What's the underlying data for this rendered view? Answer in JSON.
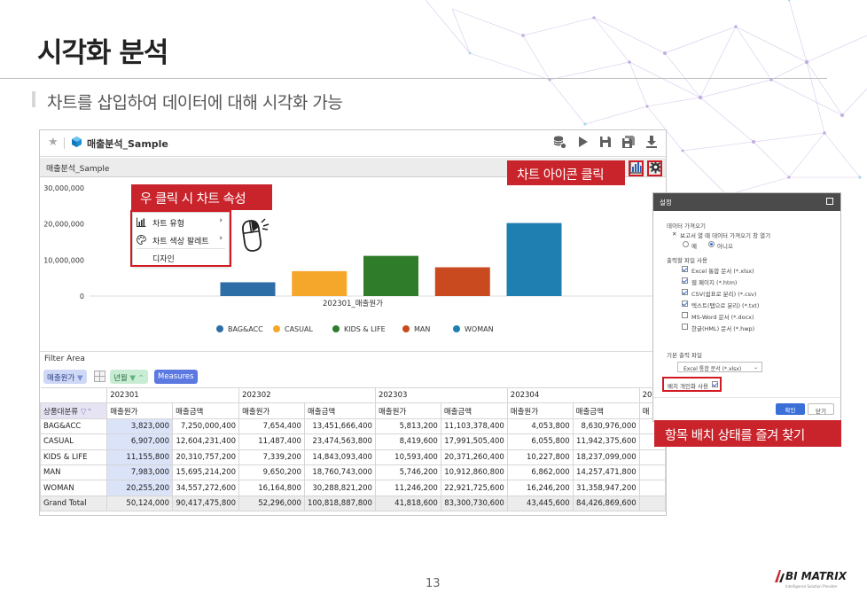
{
  "slide": {
    "title": "시각화 분석",
    "subtitle": "차트를 삽입하여 데이터에 대해 시각화 가능",
    "page_number": "13",
    "logo": {
      "text": "BI MATRIX",
      "tagline": "Intelligence Solution Provider"
    }
  },
  "window": {
    "report_title": "매출분석_Sample",
    "sheet_title": "매출분석_Sample",
    "toolbar_icons": [
      "database-run-icon",
      "play-icon",
      "save-icon",
      "save-as-icon",
      "download-icon"
    ],
    "chart_tool_icons": [
      "bar-chart-icon",
      "gear-icon"
    ]
  },
  "chart_data": {
    "type": "bar",
    "xlabel": "202301_매출원가",
    "ylim": [
      0,
      30000000
    ],
    "y_ticks": [
      "30,000,000",
      "20,000,000",
      "10,000,000",
      "0"
    ],
    "legend_position": "bottom",
    "series": [
      {
        "name": "BAG&ACC",
        "value": 3823000,
        "color": "#2e6ea7"
      },
      {
        "name": "CASUAL",
        "value": 6907000,
        "color": "#f5a72b"
      },
      {
        "name": "KIDS & LIFE",
        "value": 11155800,
        "color": "#2f7c2b"
      },
      {
        "name": "MAN",
        "value": 7983000,
        "color": "#c94a1f"
      },
      {
        "name": "WOMAN",
        "value": 20255200,
        "color": "#1f7fb0"
      }
    ]
  },
  "context_menu": {
    "items": [
      {
        "label": "차트 유형",
        "icon": "bar-chart-icon",
        "has_submenu": true
      },
      {
        "label": "차트 색상 팔레트",
        "icon": "palette-icon",
        "has_submenu": true
      },
      {
        "label": "디자인",
        "icon": "",
        "has_submenu": false
      }
    ]
  },
  "filter_area": {
    "label": "Filter Area",
    "chips": [
      {
        "label": "매출원가",
        "color": "#cfd8f5"
      },
      {
        "label": "년월",
        "color": "#c9ecd4"
      },
      {
        "label": "Measures",
        "color": "#5b79e0"
      }
    ]
  },
  "table": {
    "periods": [
      "202301",
      "202302",
      "202303",
      "202304",
      "20"
    ],
    "row_header": "상품대분류",
    "measure_headers": [
      "매출원가",
      "매출금액",
      "매출원가",
      "매출금액",
      "매출원가",
      "매출금액",
      "매출원가",
      "매출금액",
      "매"
    ],
    "rows": [
      {
        "label": "BAG&ACC",
        "values": [
          "3,823,000",
          "7,250,000,400",
          "7,654,400",
          "13,451,666,400",
          "5,813,200",
          "11,103,378,400",
          "4,053,800",
          "8,630,976,000"
        ]
      },
      {
        "label": "CASUAL",
        "values": [
          "6,907,000",
          "12,604,231,400",
          "11,487,400",
          "23,474,563,800",
          "8,419,600",
          "17,991,505,400",
          "6,055,800",
          "11,942,375,600"
        ]
      },
      {
        "label": "KIDS & LIFE",
        "values": [
          "11,155,800",
          "20,310,757,200",
          "7,339,200",
          "14,843,093,400",
          "10,593,400",
          "20,371,260,400",
          "10,227,800",
          "18,237,099,000"
        ]
      },
      {
        "label": "MAN",
        "values": [
          "7,983,000",
          "15,695,214,200",
          "9,650,200",
          "18,760,743,000",
          "5,746,200",
          "10,912,860,800",
          "6,862,000",
          "14,257,471,800"
        ]
      },
      {
        "label": "WOMAN",
        "values": [
          "20,255,200",
          "34,557,272,600",
          "16,164,800",
          "30,288,821,200",
          "11,246,200",
          "22,921,725,600",
          "16,246,200",
          "31,358,947,200"
        ]
      },
      {
        "label": "Grand Total",
        "values": [
          "50,124,000",
          "90,417,475,800",
          "52,296,000",
          "100,818,887,800",
          "41,818,600",
          "83,300,730,600",
          "43,445,600",
          "84,426,869,600"
        ]
      }
    ]
  },
  "settings_panel": {
    "title": "설정",
    "data_fetch_label": "데이터 가져오기",
    "data_fetch_option": "보고서 열 때 데이터 가져오기 창 열기",
    "radio_yes": "예",
    "radio_no": "아니오",
    "export_label": "출력할 파일 사용",
    "export_options": [
      {
        "label": "Excel 통합 문서 (*.xlsx)",
        "checked": true
      },
      {
        "label": "웹 페이지 (*.htm)",
        "checked": true
      },
      {
        "label": "CSV(쉼표로 분리) (*.csv)",
        "checked": true
      },
      {
        "label": "텍스트(탭으로 분리) (*.txt)",
        "checked": true
      },
      {
        "label": "MS-Word 문서 (*.docx)",
        "checked": false
      },
      {
        "label": "한글(HML) 문서 (*.hwp)",
        "checked": false
      }
    ],
    "default_export_label": "기본 출력 파일",
    "default_export_value": "Excel 통합 문서 (*.xlsx)",
    "layout_personalize_label": "배치 개인화 사용",
    "ok_label": "확인",
    "close_label": "닫기"
  },
  "callouts": {
    "chart_icon": "차트 아이콘 클릭",
    "right_click": "우 클릭 시 차트 속성",
    "favorites": "항목 배치 상태를 즐겨 찾기"
  }
}
